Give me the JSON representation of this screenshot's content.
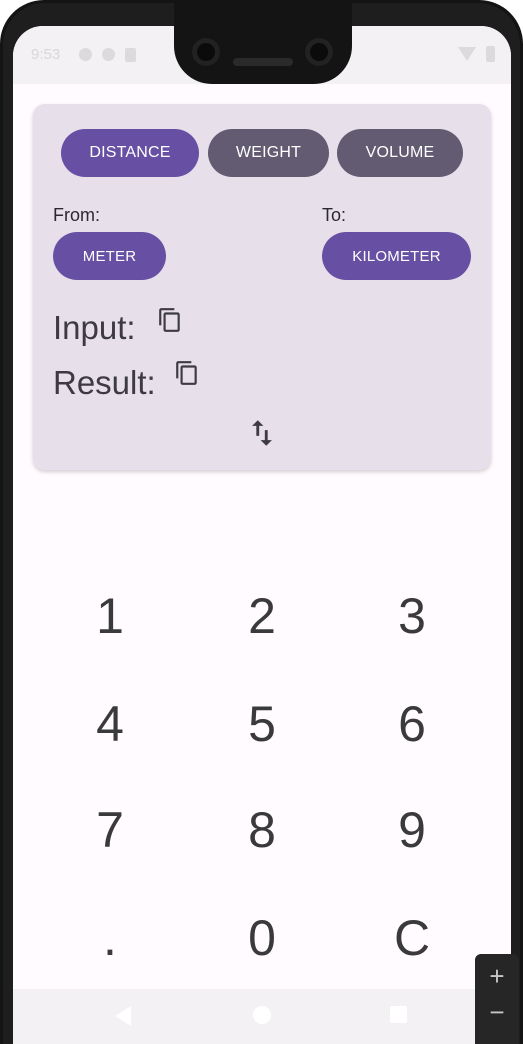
{
  "status_bar": {
    "time": "9:53"
  },
  "converter": {
    "categories": [
      {
        "label": "DISTANCE",
        "selected": true
      },
      {
        "label": "WEIGHT",
        "selected": false
      },
      {
        "label": "VOLUME",
        "selected": false
      }
    ],
    "from_label": "From:",
    "to_label": "To:",
    "from_unit": "METER",
    "to_unit": "KILOMETER",
    "input_label": "Input:",
    "result_label": "Result:"
  },
  "keypad": {
    "keys": [
      "1",
      "2",
      "3",
      "4",
      "5",
      "6",
      "7",
      "8",
      "9",
      ".",
      "0",
      "C"
    ]
  },
  "zoom_controls": {
    "zoom_in": "+",
    "zoom_out": "−"
  },
  "colors": {
    "primary": "#6750a4",
    "secondary": "#625b71",
    "card_background": "#e7e0eb",
    "screen_background": "#fffbfe"
  }
}
